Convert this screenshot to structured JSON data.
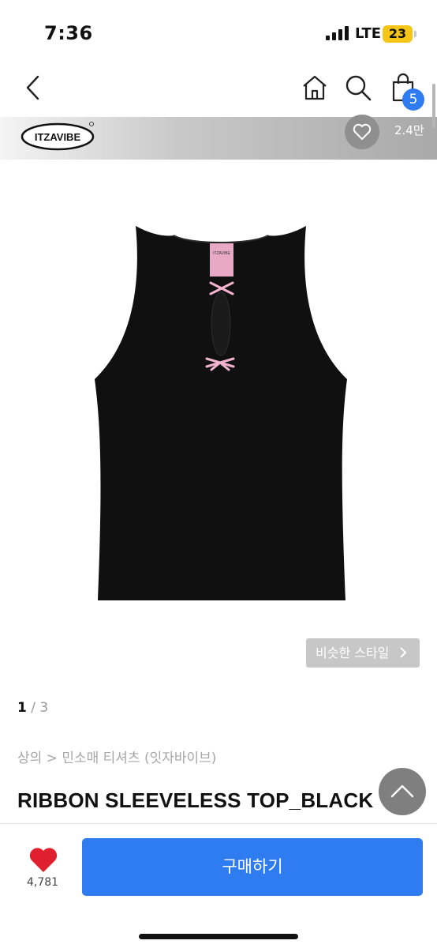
{
  "status_bar": {
    "time": "7:36",
    "network": "LTE",
    "battery": "23"
  },
  "nav": {
    "back_icon": "chevron-left-icon",
    "home_icon": "home-icon",
    "search_icon": "search-icon",
    "bag_icon": "shopping-bag-icon",
    "cart_count": "5"
  },
  "brand": {
    "logo_text": "ITZAVIBE",
    "like_icon": "heart-outline-icon",
    "like_count": "2.4만"
  },
  "gallery": {
    "similar_style_label": "비슷한 스타일",
    "current_page": "1",
    "separator": " / ",
    "total_pages": "3",
    "label_text": "ITZAVIBE"
  },
  "product": {
    "breadcrumb": "상의 > 민소매 티셔츠 (잇자바이브)",
    "name": "RIBBON SLEEVELESS TOP_BLACK"
  },
  "bottom_bar": {
    "wish_count": "4,781",
    "buy_label": "구매하기"
  },
  "colors": {
    "accent": "#2f7bf0",
    "heart": "#e0202e",
    "battery": "#f5c518"
  }
}
